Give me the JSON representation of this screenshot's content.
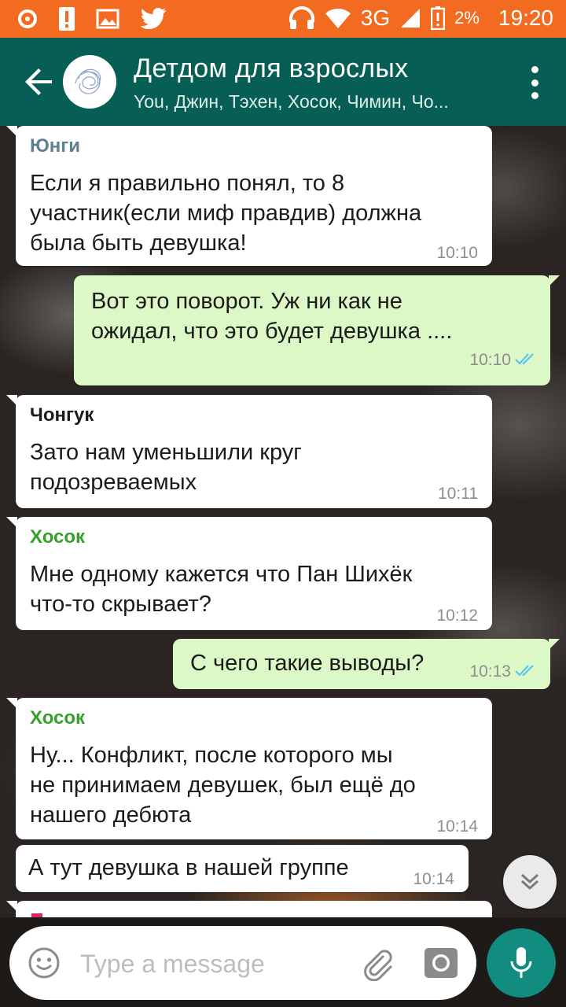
{
  "status_bar": {
    "network": "3G",
    "battery": "2%",
    "time": "19:20"
  },
  "header": {
    "title": "Детдом для взрослых",
    "subtitle": "You, Джин, Тэхен, Хосок, Чимин, Чо..."
  },
  "messages": [
    {
      "sender": "Юнги",
      "sender_color": "#5f7f93",
      "text": [
        "Если я правильно понял, то 8",
        "участник(если миф правдив) должна",
        "была быть девушка!"
      ],
      "time": "10:10"
    },
    {
      "text": [
        "Вот это поворот. Уж ни как не",
        "ожидал, что это будет девушка ...."
      ],
      "time": "10:10",
      "status": "read"
    },
    {
      "sender": "Чонгук",
      "sender_color": "#1b1b1b",
      "text": [
        "Зато нам уменьшили круг",
        "подозреваемых"
      ],
      "time": "10:11"
    },
    {
      "sender": "Хосок",
      "sender_color": "#35a02a",
      "text": [
        "Мне одному кажется что Пан Шихёк",
        "что-то скрывает?"
      ],
      "time": "10:12"
    },
    {
      "text": [
        "С чего такие выводы?"
      ],
      "time": "10:13",
      "status": "read"
    },
    {
      "sender": "Хосок",
      "sender_color": "#35a02a",
      "text": [
        "Ну... Конфликт, после которого мы",
        "не принимаем девушек, был ещё до",
        "нашего дебюта"
      ],
      "time": "10:14"
    },
    {
      "text": [
        "А тут девушка в нашей группе"
      ],
      "time": "10:14"
    }
  ],
  "composer": {
    "placeholder": "Type a message"
  },
  "colors": {
    "status_bar": "#f26b21",
    "app_bar": "#075e54",
    "outgoing_bubble": "#dcf8c6",
    "incoming_bubble": "#ffffff",
    "read_ticks": "#4fc3f7",
    "mic_button": "#128c7e"
  },
  "icons": {
    "back": "arrow-left-icon",
    "menu": "more-vert-icon",
    "scroll_down": "double-chevron-down-icon",
    "emoji": "emoji-icon",
    "attach": "paperclip-icon",
    "camera": "camera-icon",
    "mic": "mic-icon"
  }
}
